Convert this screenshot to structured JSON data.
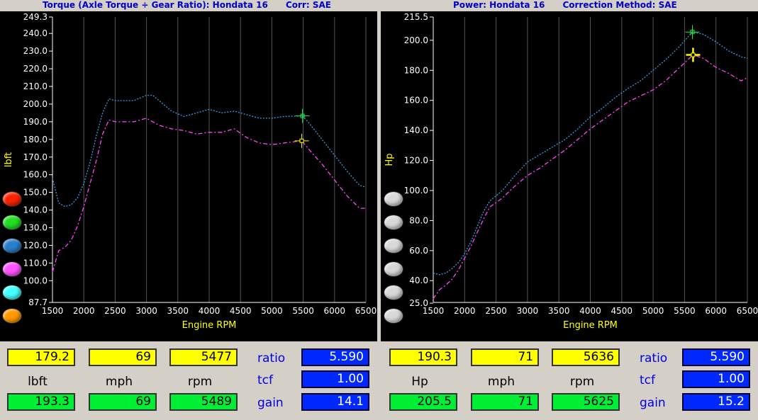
{
  "left": {
    "title": "Torque (Axle Torque ÷ Gear Ratio): Hondata 16      Corr: SAE",
    "readout": {
      "top": [
        "179.2",
        "69",
        "5477"
      ],
      "labels": [
        "lbft",
        "mph",
        "rpm"
      ],
      "bottom": [
        "193.3",
        "69",
        "5489"
      ],
      "side_labels": [
        "ratio",
        "tcf",
        "gain"
      ],
      "side_values": [
        "5.590",
        "1.00",
        "14.1"
      ]
    }
  },
  "right": {
    "title": "Power: Hondata 16      Correction Method: SAE",
    "readout": {
      "top": [
        "190.3",
        "71",
        "5636"
      ],
      "labels": [
        "Hp",
        "mph",
        "rpm"
      ],
      "bottom": [
        "205.5",
        "71",
        "5625"
      ],
      "side_labels": [
        "ratio",
        "tcf",
        "gain"
      ],
      "side_values": [
        "5.590",
        "1.00",
        "15.2"
      ]
    }
  },
  "colors": {
    "background": "#000000",
    "grid": "#555555",
    "axis_label": "#ffff00",
    "tick": "#ffffff",
    "series_blue": "#3a9adf",
    "series_magenta": "#ff44ff",
    "cursor_green": "#22ee44",
    "cursor_yellow": "#ffff00"
  },
  "left_dots": [
    "#ff2200",
    "#22dd22",
    "#2a7fcc",
    "#ff55ff",
    "#44ffff",
    "#ff9900"
  ],
  "right_dots": [
    "#d8d8d8",
    "#d8d8d8",
    "#d8d8d8",
    "#d8d8d8",
    "#d8d8d8",
    "#d8d8d8"
  ],
  "chart_data": [
    {
      "type": "line",
      "title": "Torque (Axle Torque ÷ Gear Ratio): Hondata 16",
      "xlabel": "Engine RPM",
      "ylabel": "lbft",
      "xlim": [
        1500,
        6500
      ],
      "ylim": [
        87.7,
        249.3
      ],
      "x_ticks": [
        1500,
        2000,
        2500,
        3000,
        3500,
        4000,
        4500,
        5000,
        5500,
        6000,
        6500
      ],
      "y_ticks": [
        "249.3",
        "240.0",
        "230.0",
        "220.0",
        "210.0",
        "200.0",
        "190.0",
        "180.0",
        "170.0",
        "160.0",
        "150.0",
        "140.0",
        "130.0",
        "120.0",
        "110.0",
        "100.0",
        "87.7"
      ],
      "grid": true,
      "series": [
        {
          "color": "#3a9adf",
          "x": [
            1500,
            1600,
            1700,
            1800,
            1900,
            2000,
            2100,
            2200,
            2300,
            2400,
            2500,
            2600,
            2800,
            3000,
            3100,
            3200,
            3400,
            3600,
            3800,
            4000,
            4200,
            4400,
            4600,
            4800,
            5000,
            5200,
            5489,
            5600,
            5800,
            6000,
            6200,
            6400,
            6500
          ],
          "y": [
            158,
            144,
            142,
            143,
            147,
            155,
            167,
            182,
            195,
            203,
            202,
            202,
            202,
            205,
            205,
            202,
            196,
            193,
            195,
            197,
            195,
            196,
            194,
            192,
            192,
            193,
            193.3,
            189,
            180,
            171,
            162,
            154,
            153
          ]
        },
        {
          "color": "#ff44ff",
          "x": [
            1500,
            1600,
            1700,
            1800,
            1900,
            2000,
            2100,
            2200,
            2300,
            2400,
            2500,
            2600,
            2800,
            3000,
            3100,
            3200,
            3400,
            3600,
            3800,
            4000,
            4200,
            4400,
            4600,
            4800,
            5000,
            5200,
            5477,
            5600,
            5800,
            6000,
            6200,
            6400,
            6500
          ],
          "y": [
            105,
            117,
            119,
            123,
            131,
            142,
            155,
            168,
            183,
            191,
            190,
            190,
            190,
            192,
            190,
            188,
            186,
            185,
            183,
            184,
            184,
            186,
            181,
            178,
            177,
            178,
            179.2,
            174,
            166,
            157,
            148,
            141,
            141
          ]
        }
      ],
      "cursor": {
        "green": [
          5489,
          193.3
        ],
        "yellow": [
          5477,
          179.2
        ]
      }
    },
    {
      "type": "line",
      "title": "Power: Hondata 16",
      "xlabel": "Engine RPM",
      "ylabel": "Hp",
      "xlim": [
        1500,
        6500
      ],
      "ylim": [
        25.5,
        215.5
      ],
      "x_ticks": [
        1500,
        2000,
        2500,
        3000,
        3500,
        4000,
        4500,
        5000,
        5500,
        6000,
        6500
      ],
      "y_ticks": [
        "215.5",
        "200.0",
        "180.0",
        "160.0",
        "140.0",
        "120.0",
        "100.0",
        "80.0",
        "60.0",
        "40.0",
        "25.0"
      ],
      "grid": true,
      "series": [
        {
          "color": "#3a9adf",
          "x": [
            1500,
            1600,
            1700,
            1800,
            1900,
            2000,
            2100,
            2200,
            2300,
            2400,
            2600,
            2800,
            3000,
            3200,
            3400,
            3600,
            3800,
            4000,
            4200,
            4400,
            4600,
            4800,
            5000,
            5200,
            5400,
            5625,
            5800,
            6000,
            6200,
            6400,
            6500
          ],
          "y": [
            45,
            44,
            45,
            48,
            52,
            58,
            66,
            76,
            86,
            93,
            100,
            110,
            119,
            124,
            129,
            134,
            141,
            149,
            155,
            162,
            168,
            173,
            180,
            187,
            195,
            205.5,
            204,
            199,
            193,
            189,
            188
          ]
        },
        {
          "color": "#ff44ff",
          "x": [
            1500,
            1600,
            1700,
            1800,
            1900,
            2000,
            2100,
            2200,
            2300,
            2400,
            2600,
            2800,
            3000,
            3200,
            3400,
            3600,
            3800,
            4000,
            4200,
            4400,
            4600,
            4800,
            5000,
            5200,
            5400,
            5636,
            5800,
            6000,
            6200,
            6400,
            6500
          ],
          "y": [
            28,
            34,
            37,
            41,
            47,
            55,
            63,
            72,
            81,
            89,
            95,
            103,
            110,
            115,
            121,
            127,
            134,
            141,
            147,
            153,
            159,
            163,
            167,
            173,
            181,
            190.3,
            188,
            182,
            178,
            173,
            175
          ]
        }
      ],
      "cursor": {
        "green": [
          5625,
          205.5
        ],
        "yellow": [
          5636,
          190.3
        ]
      }
    }
  ]
}
